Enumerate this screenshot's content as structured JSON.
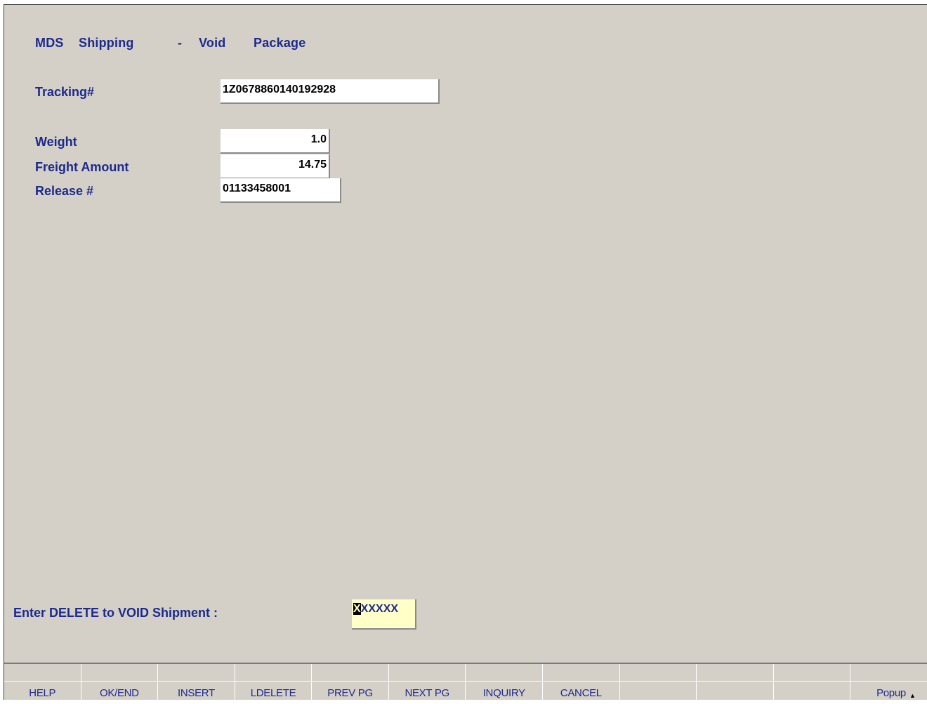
{
  "header": {
    "title_parts": [
      "MDS",
      "Shipping",
      "-",
      "Void",
      "Package"
    ]
  },
  "fields": {
    "tracking": {
      "label": "Tracking#",
      "value": "1Z0678860140192928"
    },
    "weight": {
      "label": "Weight",
      "value": "1.0"
    },
    "freight": {
      "label": "Freight Amount",
      "value": "14.75"
    },
    "release": {
      "label": "Release #",
      "value": "01133458001"
    }
  },
  "prompt": {
    "label": "Enter DELETE to VOID Shipment :",
    "cursor_char": "X",
    "value_rest": "XXXXX"
  },
  "fkeys": [
    "HELP",
    "OK/END",
    "INSERT",
    "LDELETE",
    "PREV PG",
    "NEXT PG",
    "INQUIRY",
    "CANCEL",
    "",
    "",
    "",
    "Popup"
  ],
  "colors": {
    "label_blue": "#1c2a8c",
    "background": "#d4d0c8",
    "prompt_field": "#ffffc8"
  }
}
